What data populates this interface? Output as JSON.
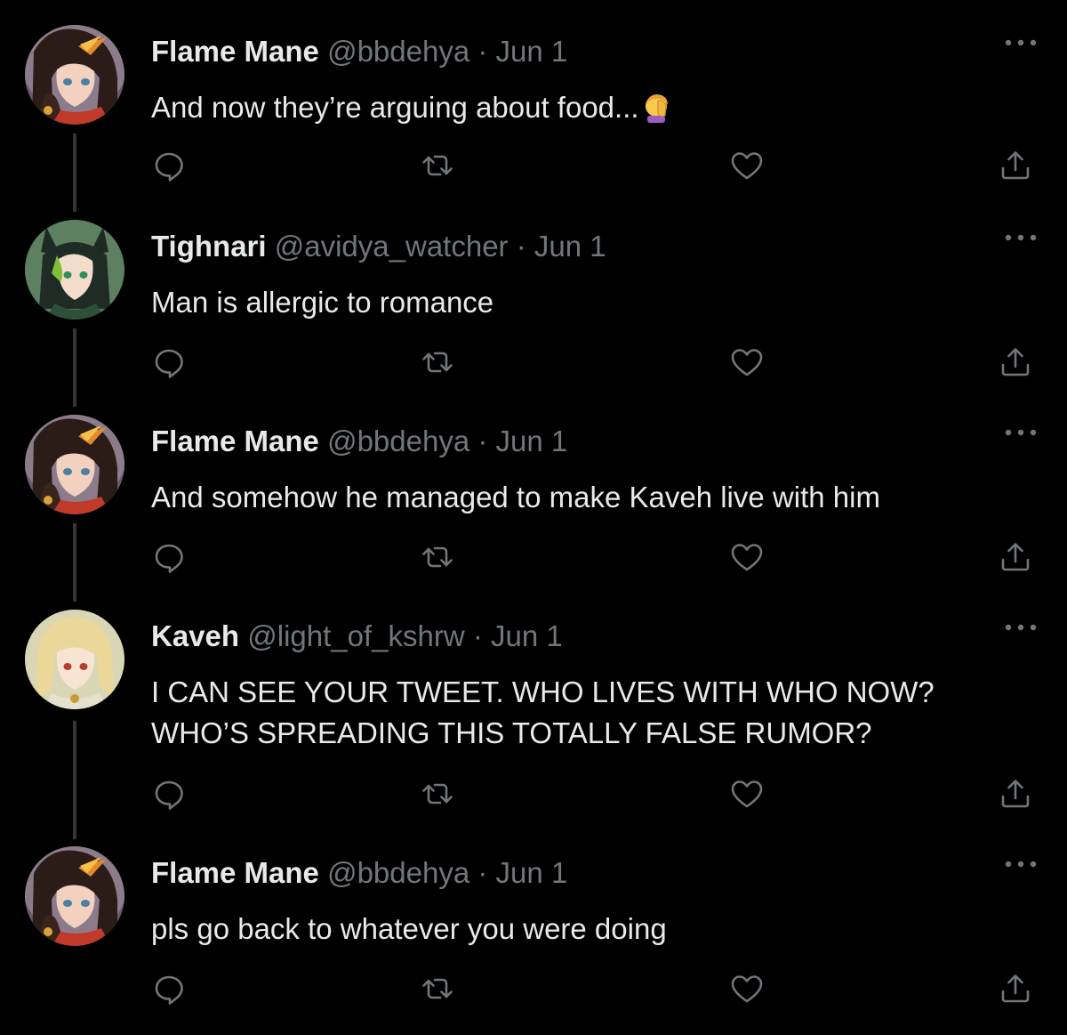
{
  "colors": {
    "background": "#000000",
    "text": "#e7e9ea",
    "muted": "#71767b",
    "thread_line": "#333639"
  },
  "tweets": [
    {
      "name": "Flame Mane",
      "handle": "@bbdehya",
      "separator": "·",
      "date": "Jun 1",
      "text": "And now they’re arguing about food...",
      "emoji": "facepalm-emoji",
      "avatar": "flame-mane-avatar"
    },
    {
      "name": "Tighnari",
      "handle": "@avidya_watcher",
      "separator": "·",
      "date": "Jun 1",
      "text": "Man is allergic to romance",
      "avatar": "tighnari-avatar"
    },
    {
      "name": "Flame Mane",
      "handle": "@bbdehya",
      "separator": "·",
      "date": "Jun 1",
      "text": "And somehow he managed to make Kaveh live with him",
      "avatar": "flame-mane-avatar"
    },
    {
      "name": "Kaveh",
      "handle": "@light_of_kshrw",
      "separator": "·",
      "date": "Jun 1",
      "text": "I CAN SEE YOUR TWEET. WHO LIVES WITH WHO NOW? WHO’S SPREADING THIS TOTALLY FALSE RUMOR?",
      "avatar": "kaveh-avatar"
    },
    {
      "name": "Flame Mane",
      "handle": "@bbdehya",
      "separator": "·",
      "date": "Jun 1",
      "text": "pls go back to whatever you were doing",
      "avatar": "flame-mane-avatar"
    }
  ],
  "action_icons": [
    "reply-icon",
    "retweet-icon",
    "like-icon",
    "share-icon"
  ],
  "menu_icon": "more-options-icon"
}
